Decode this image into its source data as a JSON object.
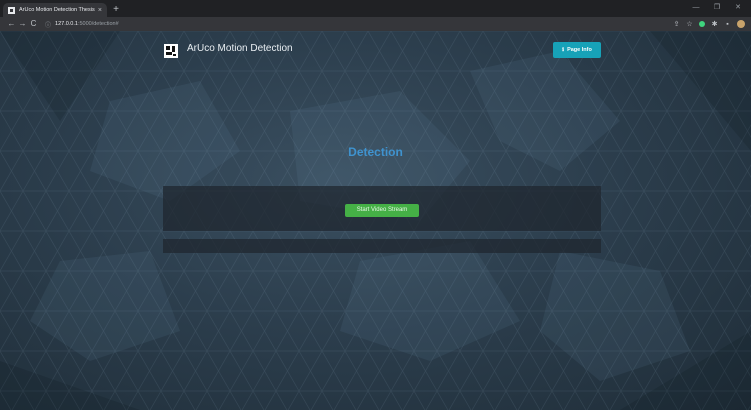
{
  "browser": {
    "tab_title": "ArUco Motion Detection Thesis",
    "tab_close": "×",
    "new_tab": "+",
    "url_host": "127.0.0.1",
    "url_path": ":5000/detection#",
    "window_controls": [
      "—",
      "❐",
      "✕"
    ]
  },
  "navbar": {
    "brand": "ArUco Motion Detection",
    "page_info_label": "Page Info",
    "page_info_icon": "ℹ"
  },
  "main": {
    "heading": "Detection",
    "start_button": "Start Video Stream"
  },
  "colors": {
    "accent_info": "#17a2b8",
    "success": "#45b046",
    "heading": "#3f93cf"
  },
  "icons": [
    "back-icon",
    "forward-icon",
    "reload-icon",
    "info-icon",
    "share-icon",
    "star-icon",
    "extension-icon",
    "puzzle-icon",
    "sidebar-icon",
    "profile-avatar"
  ]
}
